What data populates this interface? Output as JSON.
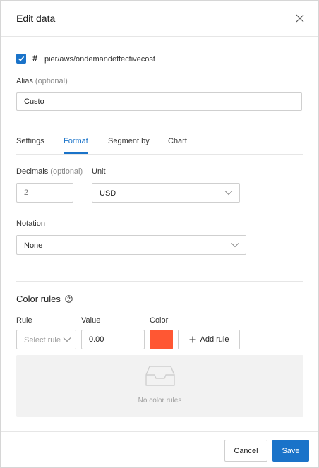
{
  "dialog": {
    "title": "Edit data"
  },
  "metric": {
    "checked": true,
    "type_symbol": "#",
    "name": "pier/aws/ondemandeffectivecost"
  },
  "alias": {
    "label": "Alias",
    "optional": "(optional)",
    "value": "Custo"
  },
  "tabs": [
    {
      "label": "Settings",
      "active": false
    },
    {
      "label": "Format",
      "active": true
    },
    {
      "label": "Segment by",
      "active": false
    },
    {
      "label": "Chart",
      "active": false
    }
  ],
  "format": {
    "decimals_label": "Decimals",
    "decimals_optional": "(optional)",
    "decimals_placeholder": "2",
    "unit_label": "Unit",
    "unit_value": "USD",
    "notation_label": "Notation",
    "notation_value": "None"
  },
  "color_rules": {
    "title": "Color rules",
    "rule_label": "Rule",
    "rule_placeholder": "Select rule",
    "value_label": "Value",
    "value": "0.00",
    "color_label": "Color",
    "color": "#ff5733",
    "add_rule_label": "Add rule",
    "empty_text": "No color rules"
  },
  "footer": {
    "cancel_label": "Cancel",
    "save_label": "Save"
  },
  "colors": {
    "accent": "#1a73c9",
    "rule_color": "#ff5733"
  },
  "icons": {
    "close": "close-icon",
    "check": "check-icon",
    "help": "help-circle-icon",
    "chevron": "chevron-down-icon",
    "plus": "plus-icon",
    "empty": "inbox-icon"
  }
}
